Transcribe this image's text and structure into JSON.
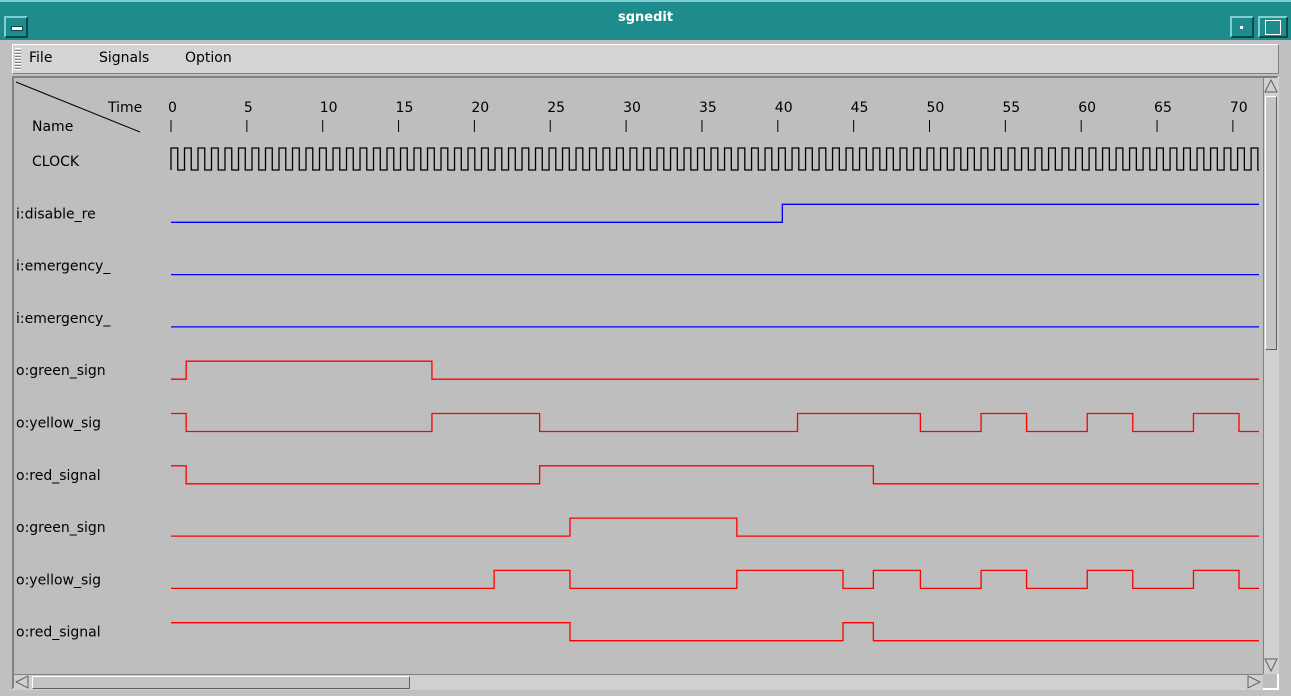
{
  "window": {
    "title": "sgnedit"
  },
  "menu": {
    "items": [
      {
        "label": "File"
      },
      {
        "label": "Signals"
      },
      {
        "label": "Option"
      }
    ]
  },
  "header": {
    "time_label": "Time",
    "name_label": "Name"
  },
  "timeline": {
    "start": 0,
    "end": 72,
    "ticks": [
      0,
      5,
      10,
      15,
      20,
      25,
      30,
      35,
      40,
      45,
      50,
      55,
      60,
      65,
      70
    ],
    "clock_period": 0.89
  },
  "signals": [
    {
      "name": "CLOCK",
      "kind": "clock",
      "color": "#000000"
    },
    {
      "name": "i:disable_re",
      "kind": "wave",
      "color": "#0000ff",
      "initial": 0,
      "transitions": [
        40.3
      ]
    },
    {
      "name": "i:emergency_",
      "kind": "wave",
      "color": "#0000ff",
      "initial": 0,
      "transitions": []
    },
    {
      "name": "i:emergency_",
      "kind": "wave",
      "color": "#0000ff",
      "initial": 0,
      "transitions": []
    },
    {
      "name": "o:green_sign",
      "kind": "wave",
      "color": "#ff0000",
      "initial": 0,
      "transitions": [
        1,
        17.2
      ]
    },
    {
      "name": "o:yellow_sig",
      "kind": "wave",
      "color": "#ff0000",
      "initial": 1,
      "transitions": [
        1,
        17.2,
        24.3,
        41.3,
        49.4,
        53.4,
        56.4,
        60.4,
        63.4,
        67.4,
        70.4
      ]
    },
    {
      "name": "o:red_signal",
      "kind": "wave",
      "color": "#ff0000",
      "initial": 1,
      "transitions": [
        1,
        24.3,
        46.3
      ]
    },
    {
      "name": "o:green_sign",
      "kind": "wave",
      "color": "#ff0000",
      "initial": 0,
      "transitions": [
        26.3,
        37.3
      ]
    },
    {
      "name": "o:yellow_sig",
      "kind": "wave",
      "color": "#ff0000",
      "initial": 0,
      "transitions": [
        21.3,
        26.3,
        37.3,
        44.3,
        46.3,
        49.4,
        53.4,
        56.4,
        60.4,
        63.4,
        67.4,
        70.4
      ]
    },
    {
      "name": "o:red_signal",
      "kind": "wave",
      "color": "#ff0000",
      "initial": 1,
      "transitions": [
        26.3,
        44.3,
        46.3
      ]
    }
  ],
  "colors": {
    "titlebar": "#1e8c8c",
    "background": "#bebebe"
  }
}
